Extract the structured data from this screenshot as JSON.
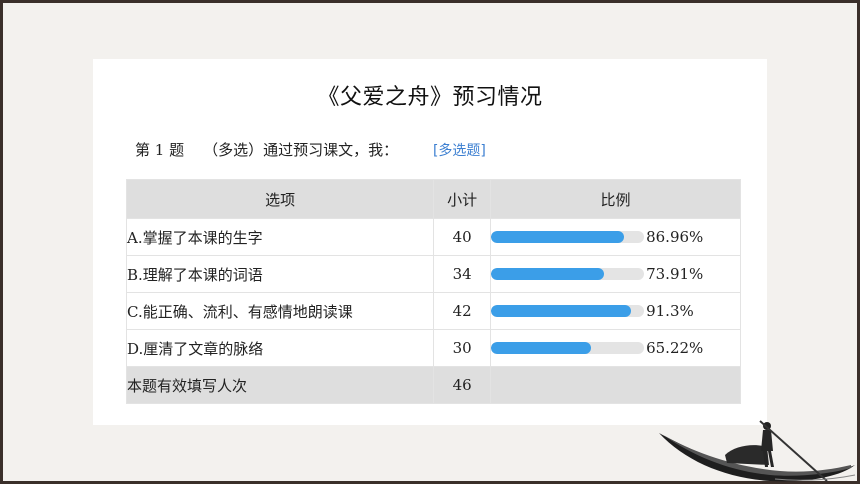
{
  "title": "《父爱之舟》预习情况",
  "question": {
    "number": "第 1 题",
    "text": "（多选）通过预习课文，我：",
    "type_label": "[多选题]"
  },
  "table": {
    "headers": {
      "option": "选项",
      "count": "小计",
      "ratio": "比例"
    },
    "rows": [
      {
        "option": "A.掌握了本课的生字",
        "count": "40",
        "percent": "86.96%",
        "fraction": 0.8696
      },
      {
        "option": "B.理解了本课的词语",
        "count": "34",
        "percent": "73.91%",
        "fraction": 0.7391
      },
      {
        "option": "C.能正确、流利、有感情地朗读课",
        "count": "42",
        "percent": "91.3%",
        "fraction": 0.913
      },
      {
        "option": "D.厘清了文章的脉络",
        "count": "30",
        "percent": "65.22%",
        "fraction": 0.6522
      }
    ],
    "total": {
      "label": "本题有效填写人次",
      "count": "46"
    }
  },
  "colors": {
    "bar_fill": "#3b9ee8",
    "bar_track": "#e4e4e4",
    "header_bg": "#dedede",
    "question_type": "#3c7fd1",
    "frame": "#3a2f2a"
  },
  "decoration": "boat-with-boatman-ink-painting"
}
